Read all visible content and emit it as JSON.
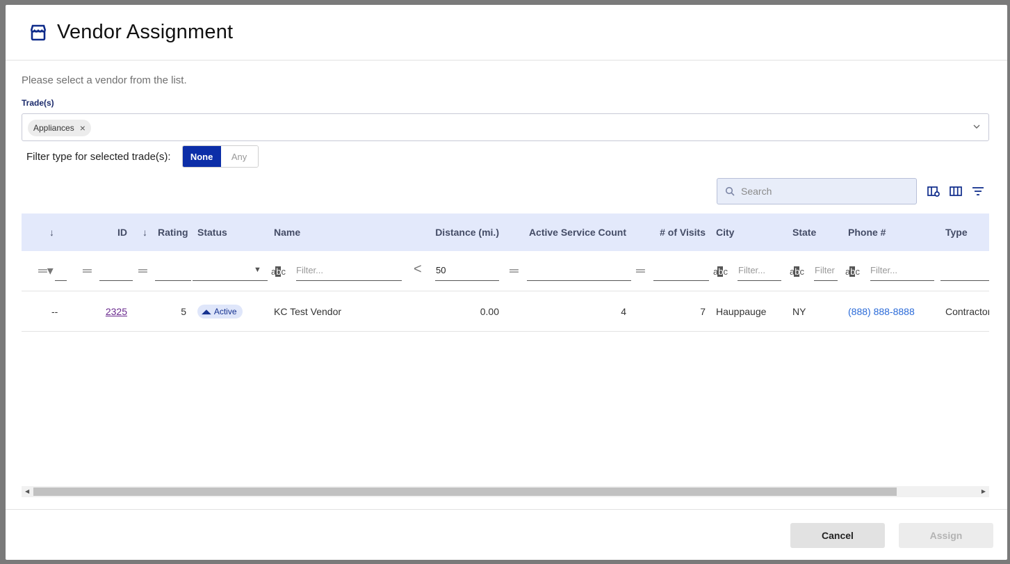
{
  "dialog": {
    "title": "Vendor Assignment",
    "instructions": "Please select a vendor from the list."
  },
  "trades": {
    "label": "Trade(s)",
    "selected": [
      "Appliances"
    ]
  },
  "filter_type": {
    "label": "Filter type for selected trade(s):",
    "options": [
      "None",
      "Any"
    ],
    "selected": "None"
  },
  "search": {
    "placeholder": "Search"
  },
  "table": {
    "columns": [
      "",
      "ID",
      "Rating",
      "Status",
      "Name",
      "Distance (mi.)",
      "Active Service Count",
      "# of Visits",
      "City",
      "State",
      "Phone #",
      "Type"
    ],
    "filters": {
      "name_placeholder": "Filter...",
      "distance_operator": "<",
      "distance_value": "50",
      "city_placeholder": "Filter...",
      "state_placeholder": "Filter",
      "phone_placeholder": "Filter..."
    },
    "rows": [
      {
        "select": "--",
        "id": "2325",
        "rating": "5",
        "status": "Active",
        "name": "KC Test Vendor",
        "distance": "0.00",
        "active_service_count": "4",
        "visits": "7",
        "city": "Hauppauge",
        "state": "NY",
        "phone": "(888) 888-8888",
        "type": "Contractor"
      }
    ]
  },
  "footer": {
    "cancel_label": "Cancel",
    "assign_label": "Assign"
  },
  "colors": {
    "accent": "#0c2ea8",
    "header_bg": "#e3e9fb"
  }
}
